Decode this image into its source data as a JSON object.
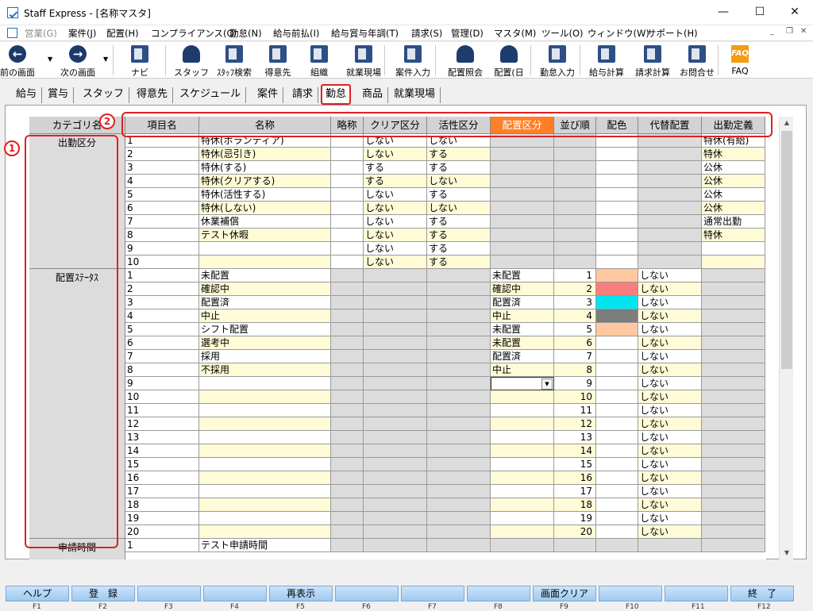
{
  "window": {
    "title": "Staff Express - [名称マスタ]"
  },
  "menu": [
    "営業(G)",
    "案件(J)",
    "配置(H)",
    "コンプライアンス(C)",
    "勤怠(N)",
    "給与前払(I)",
    "給与賞与年調(T)",
    "請求(S)",
    "管理(D)",
    "マスタ(M)",
    "ツール(O)",
    "ウィンドウ(W)",
    "サポート(H)"
  ],
  "toolbar": [
    {
      "label": "前の画面",
      "icon": "back-icon"
    },
    {
      "label": "次の画面",
      "icon": "forward-icon"
    },
    {
      "label": "ナビ",
      "icon": "navi-icon"
    },
    {
      "label": "スタッフ",
      "icon": "staff-icon"
    },
    {
      "label": "ｽﾀｯﾌ検索",
      "icon": "staff-search-icon"
    },
    {
      "label": "得意先",
      "icon": "client-icon"
    },
    {
      "label": "組織",
      "icon": "organization-icon"
    },
    {
      "label": "就業現場",
      "icon": "worksite-icon"
    },
    {
      "label": "案件入力",
      "icon": "case-entry-icon"
    },
    {
      "label": "配置照会",
      "icon": "placement-inquiry-icon"
    },
    {
      "label": "配置(日",
      "icon": "placement-day-icon"
    },
    {
      "label": "勤怠入力",
      "icon": "attendance-entry-icon"
    },
    {
      "label": "給与計算",
      "icon": "payroll-icon"
    },
    {
      "label": "請求計算",
      "icon": "billing-icon"
    },
    {
      "label": "お問合せ",
      "icon": "inquiry-icon"
    },
    {
      "label": "FAQ",
      "icon": "faq-icon"
    }
  ],
  "tabs": [
    "給与",
    "賞与",
    "スタッフ",
    "得意先",
    "スケジュール",
    "案件",
    "請求",
    "勤怠",
    "商品",
    "就業現場"
  ],
  "active_tab": "勤怠",
  "columns": [
    "カテゴリ名",
    "項目名",
    "名称",
    "略称",
    "クリア区分",
    "活性区分",
    "配置区分",
    "並び順",
    "配色",
    "代替配置",
    "出勤定義"
  ],
  "categories": {
    "attendance": "出勤区分",
    "placement_status": "配置ｽﾃｰﾀｽ",
    "application_time": "申請時間"
  },
  "attendance_rows": [
    {
      "item": "1",
      "name": "特休(ボランティア)",
      "clear": "しない",
      "active": "しない",
      "def": "特休(有給)"
    },
    {
      "item": "2",
      "name": "特休(忌引き)",
      "clear": "しない",
      "active": "する",
      "def": "特休"
    },
    {
      "item": "3",
      "name": "特休(する)",
      "clear": "する",
      "active": "する",
      "def": "公休"
    },
    {
      "item": "4",
      "name": "特休(クリアする)",
      "clear": "する",
      "active": "しない",
      "def": "公休"
    },
    {
      "item": "5",
      "name": "特休(活性する)",
      "clear": "しない",
      "active": "する",
      "def": "公休"
    },
    {
      "item": "6",
      "name": "特休(しない)",
      "clear": "しない",
      "active": "しない",
      "def": "公休"
    },
    {
      "item": "7",
      "name": "休業補償",
      "clear": "しない",
      "active": "する",
      "def": "通常出勤"
    },
    {
      "item": "8",
      "name": "テスト休暇",
      "clear": "しない",
      "active": "する",
      "def": "特休"
    },
    {
      "item": "9",
      "name": "",
      "clear": "しない",
      "active": "する",
      "def": ""
    },
    {
      "item": "10",
      "name": "",
      "clear": "しない",
      "active": "する",
      "def": ""
    }
  ],
  "status_rows": [
    {
      "item": "1",
      "name": "未配置",
      "kubun": "未配置",
      "order": "1",
      "color": "#ffc8a0",
      "alt": "しない"
    },
    {
      "item": "2",
      "name": "確認中",
      "kubun": "確認中",
      "order": "2",
      "color": "#f87d7d",
      "alt": "しない"
    },
    {
      "item": "3",
      "name": "配置済",
      "kubun": "配置済",
      "order": "3",
      "color": "#00e5f0",
      "alt": "しない"
    },
    {
      "item": "4",
      "name": "中止",
      "kubun": "中止",
      "order": "4",
      "color": "#7d7d7d",
      "alt": "しない"
    },
    {
      "item": "5",
      "name": "シフト配置",
      "kubun": "未配置",
      "order": "5",
      "color": "#ffc8a0",
      "alt": "しない"
    },
    {
      "item": "6",
      "name": "選考中",
      "kubun": "未配置",
      "order": "6",
      "color": "",
      "alt": "しない"
    },
    {
      "item": "7",
      "name": "採用",
      "kubun": "配置済",
      "order": "7",
      "color": "",
      "alt": "しない"
    },
    {
      "item": "8",
      "name": "不採用",
      "kubun": "中止",
      "order": "8",
      "color": "",
      "alt": "しない"
    },
    {
      "item": "9",
      "name": "",
      "kubun": "",
      "order": "9",
      "color": "",
      "alt": "しない"
    },
    {
      "item": "10",
      "name": "",
      "kubun": "",
      "order": "10",
      "color": "",
      "alt": "しない"
    },
    {
      "item": "11",
      "name": "",
      "kubun": "",
      "order": "11",
      "color": "",
      "alt": "しない"
    },
    {
      "item": "12",
      "name": "",
      "kubun": "",
      "order": "12",
      "color": "",
      "alt": "しない"
    },
    {
      "item": "13",
      "name": "",
      "kubun": "",
      "order": "13",
      "color": "",
      "alt": "しない"
    },
    {
      "item": "14",
      "name": "",
      "kubun": "",
      "order": "14",
      "color": "",
      "alt": "しない"
    },
    {
      "item": "15",
      "name": "",
      "kubun": "",
      "order": "15",
      "color": "",
      "alt": "しない"
    },
    {
      "item": "16",
      "name": "",
      "kubun": "",
      "order": "16",
      "color": "",
      "alt": "しない"
    },
    {
      "item": "17",
      "name": "",
      "kubun": "",
      "order": "17",
      "color": "",
      "alt": "しない"
    },
    {
      "item": "18",
      "name": "",
      "kubun": "",
      "order": "18",
      "color": "",
      "alt": "しない"
    },
    {
      "item": "19",
      "name": "",
      "kubun": "",
      "order": "19",
      "color": "",
      "alt": "しない"
    },
    {
      "item": "20",
      "name": "",
      "kubun": "",
      "order": "20",
      "color": "",
      "alt": "しない"
    }
  ],
  "application_rows": [
    {
      "item": "1",
      "name": "テスト申請時間"
    }
  ],
  "annotations": {
    "badge1": "1",
    "badge2": "2"
  },
  "fkeys": [
    {
      "label": "ヘルプ",
      "key": "F1"
    },
    {
      "label": "登　録",
      "key": "F2"
    },
    {
      "label": "",
      "key": "F3"
    },
    {
      "label": "",
      "key": "F4"
    },
    {
      "label": "再表示",
      "key": "F5"
    },
    {
      "label": "",
      "key": "F6"
    },
    {
      "label": "",
      "key": "F7"
    },
    {
      "label": "",
      "key": "F8"
    },
    {
      "label": "画面クリア",
      "key": "F9"
    },
    {
      "label": "",
      "key": "F10"
    },
    {
      "label": "",
      "key": "F11"
    },
    {
      "label": "終　了",
      "key": "F12"
    }
  ]
}
